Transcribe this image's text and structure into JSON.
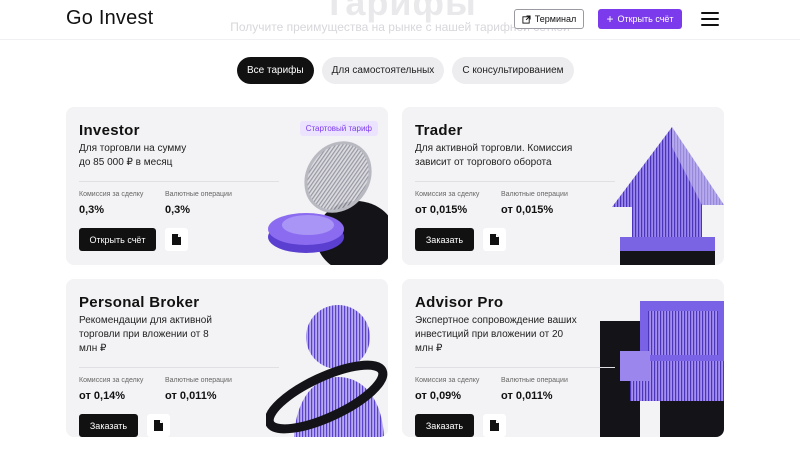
{
  "page": {
    "bg_title": "Тарифы",
    "bg_subtitle": "Получите преимущества на рынке с нашей тарифной сеткой"
  },
  "header": {
    "logo": "Go Invest",
    "terminal_label": "Терминал",
    "open_account_label": "Открыть счёт"
  },
  "filters": [
    {
      "label": "Все тарифы",
      "active": true
    },
    {
      "label": "Для самостоятельных",
      "active": false
    },
    {
      "label": "С консультированием",
      "active": false
    }
  ],
  "cards": [
    {
      "title": "Investor",
      "desc": "Для торговли на сумму до 85 000 ₽ в месяц",
      "badge": "Стартовый тариф",
      "metric1_label": "Комиссия за сделку",
      "metric1_value": "0,3%",
      "metric2_label": "Валютные операции",
      "metric2_value": "0,3%",
      "button": "Открыть счёт"
    },
    {
      "title": "Trader",
      "desc": "Для активной торговли. Комиссия зависит от торгового оборота",
      "metric1_label": "Комиссия за сделку",
      "metric1_value": "от 0,015%",
      "metric2_label": "Валютные операции",
      "metric2_value": "от 0,015%",
      "button": "Заказать"
    },
    {
      "title": "Personal Broker",
      "desc": "Рекомендации для активной торговли при вложении от 8 млн ₽",
      "metric1_label": "Комиссия за сделку",
      "metric1_value": "от 0,14%",
      "metric2_label": "Валютные операции",
      "metric2_value": "от 0,011%",
      "button": "Заказать"
    },
    {
      "title": "Advisor Pro",
      "desc": "Экспертное сопровождение ваших инвестиций при вложении от 20 млн ₽",
      "metric1_label": "Комиссия за сделку",
      "metric1_value": "от 0,09%",
      "metric2_label": "Валютные операции",
      "metric2_value": "от 0,011%",
      "button": "Заказать"
    }
  ],
  "colors": {
    "accent": "#7c3aed",
    "dark": "#111111",
    "card_bg": "#f3f3f5"
  },
  "icons": [
    "external-link-icon",
    "plus-icon",
    "menu-icon",
    "document-icon"
  ]
}
